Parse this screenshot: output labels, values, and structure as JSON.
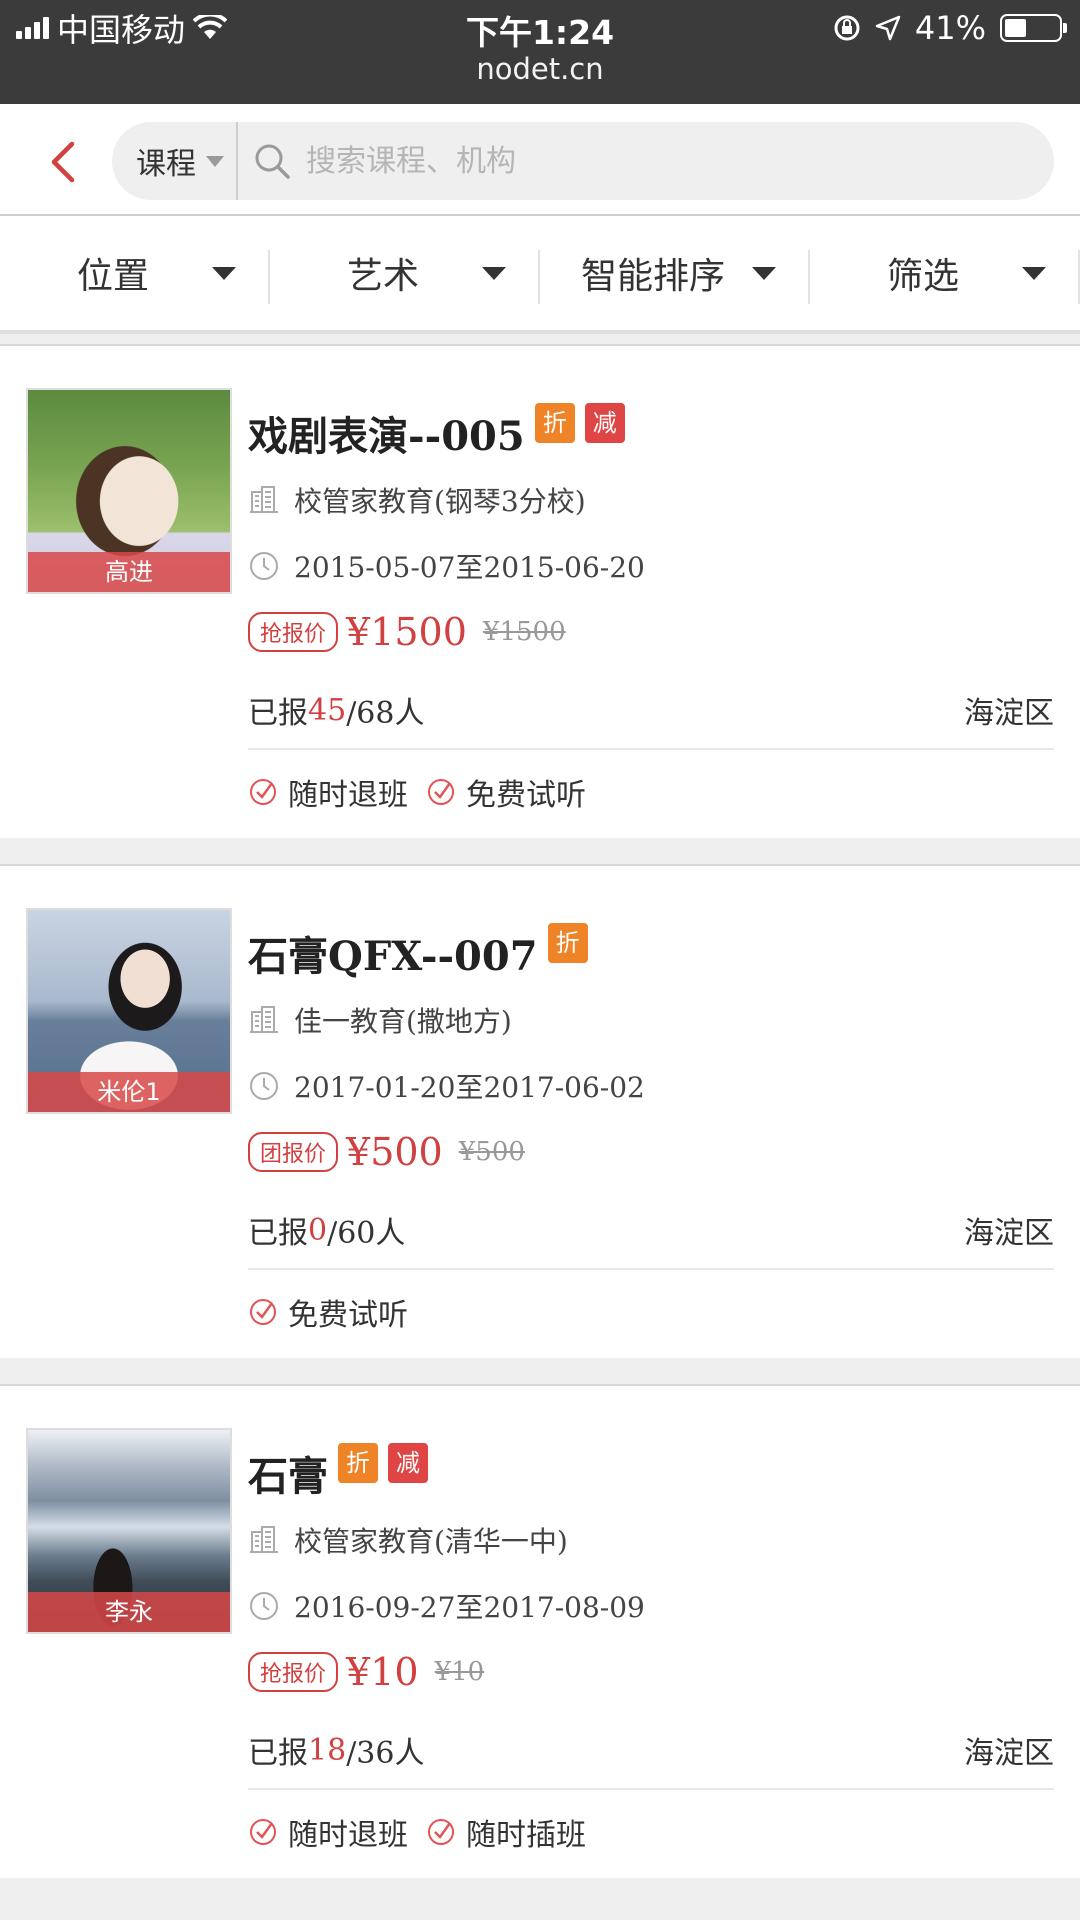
{
  "status_bar": {
    "carrier": "中国移动",
    "time": "下午1:24",
    "url": "nodet.cn",
    "battery": "41%",
    "battery_level": 0.41
  },
  "search": {
    "category": "课程",
    "placeholder": "搜索课程、机构"
  },
  "filters": [
    {
      "label": "位置"
    },
    {
      "label": "艺术"
    },
    {
      "label": "智能排序"
    },
    {
      "label": "筛选"
    }
  ],
  "courses": [
    {
      "name": "戏剧表演--005",
      "tags": [
        "折",
        "减"
      ],
      "teacher": "高进",
      "org": "校管家教育(钢琴3分校)",
      "dates": "2015-05-07至2015-06-20",
      "price_type": "抢报价",
      "price": "¥1500",
      "old_price": "¥1500",
      "enroll_prefix": "已报",
      "enrolled": "45",
      "enroll_rest": "/68人",
      "district": "海淀区",
      "features": [
        "随时退班",
        "免费试听"
      ]
    },
    {
      "name": "石膏QFX--007",
      "tags": [
        "折"
      ],
      "teacher": "米伦1",
      "org": "佳一教育(撒地方)",
      "dates": "2017-01-20至2017-06-02",
      "price_type": "团报价",
      "price": "¥500",
      "old_price": "¥500",
      "enroll_prefix": "已报",
      "enrolled": "0",
      "enroll_rest": "/60人",
      "district": "海淀区",
      "features": [
        "免费试听"
      ]
    },
    {
      "name": "石膏",
      "tags": [
        "折",
        "减"
      ],
      "teacher": "李永",
      "org": "校管家教育(清华一中)",
      "dates": "2016-09-27至2017-08-09",
      "price_type": "抢报价",
      "price": "¥10",
      "old_price": "¥10",
      "enroll_prefix": "已报",
      "enrolled": "18",
      "enroll_rest": "/36人",
      "district": "海淀区",
      "features": [
        "随时退班",
        "随时插班"
      ]
    }
  ],
  "colors": {
    "accent": "#d24040",
    "discount_tag": "#ee8327",
    "reduce_tag": "#df4545",
    "status_bar": "#3b3b3b"
  },
  "icons": [
    "back-arrow-icon",
    "search-icon",
    "building-icon",
    "clock-icon",
    "check-circle-icon",
    "wifi-icon",
    "location-arrow-icon",
    "lock-rotation-icon",
    "battery-icon"
  ]
}
